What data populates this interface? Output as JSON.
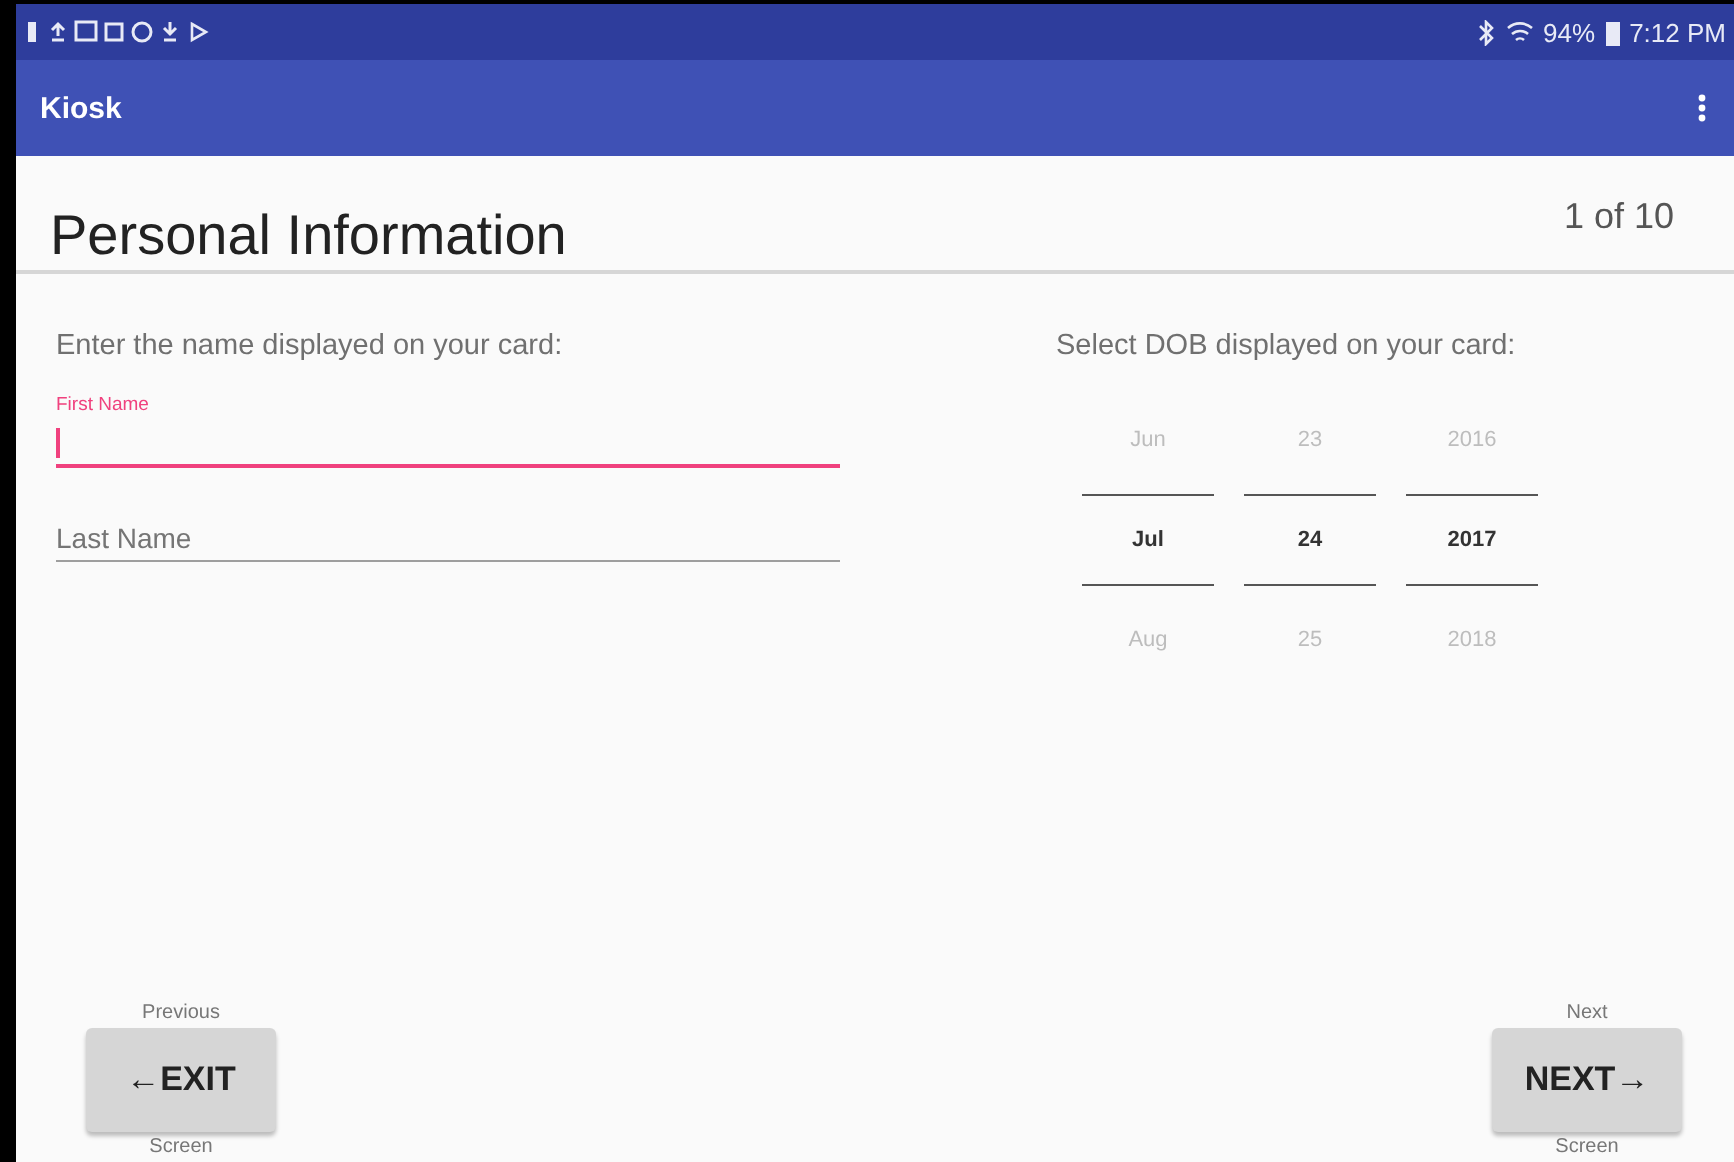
{
  "status_bar": {
    "battery": "94%",
    "time": "7:12 PM"
  },
  "app_bar": {
    "title": "Kiosk"
  },
  "header": {
    "title": "Personal Information",
    "step": "1 of 10"
  },
  "name_section": {
    "prompt": "Enter the name displayed on your card:",
    "fields": [
      {
        "label": "First Name",
        "focused": true
      },
      {
        "label": "Last Name",
        "focused": false
      }
    ]
  },
  "dob_section": {
    "prompt": "Select DOB displayed on your card:",
    "columns": [
      {
        "items": [
          {
            "text": "Jun",
            "selected": false
          },
          {
            "text": "Jul",
            "selected": true
          },
          {
            "text": "Aug",
            "selected": false
          }
        ]
      },
      {
        "items": [
          {
            "text": "23",
            "selected": false
          },
          {
            "text": "24",
            "selected": true
          },
          {
            "text": "25",
            "selected": false
          }
        ]
      },
      {
        "items": [
          {
            "text": "2016",
            "selected": false
          },
          {
            "text": "2017",
            "selected": true
          },
          {
            "text": "2018",
            "selected": false
          }
        ]
      }
    ]
  },
  "nav": [
    {
      "above": "Previous",
      "label": "←EXIT",
      "below": "Screen"
    },
    {
      "above": "Next",
      "label": "NEXT→",
      "below": "Screen"
    }
  ]
}
